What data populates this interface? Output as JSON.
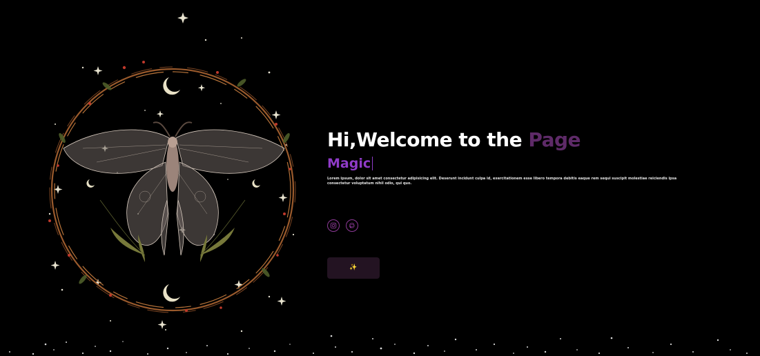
{
  "hero": {
    "title_main": "Hi,Welcome to the ",
    "title_accent": "Page",
    "typed_word": "Magic",
    "description": "Lorem ipsum, dolor sit amet consectetur adipisicing elit. Deserunt incidunt culpa id, exercitationem esse libero tempora debitis eaque rem sequi suscipit molestiae reiciendis ipsa consectetur voluptatum nihil odio, qui quo."
  },
  "socials": [
    {
      "icon": "instagram-icon"
    },
    {
      "icon": "github-icon"
    }
  ],
  "cta": {
    "icon": "sparkle-icon",
    "glyph": "✨"
  },
  "colors": {
    "background": "#000000",
    "accent_dark": "#5e2a68",
    "accent_bright": "#8f3bc8",
    "social_ring": "#8e3a98",
    "button_bg": "#231322"
  }
}
